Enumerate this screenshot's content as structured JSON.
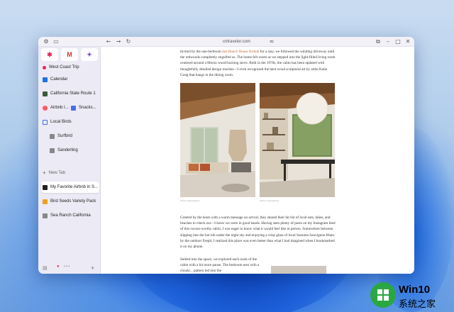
{
  "window": {
    "url": "cntravelor.com"
  },
  "sidebar": {
    "favorites": [
      {
        "icon": "slack-icon",
        "label": "✱",
        "color": "#e0285a"
      },
      {
        "icon": "gmail-icon",
        "label": "M",
        "color": "#d93025"
      },
      {
        "icon": "copilot-icon",
        "label": "✦",
        "color": "#7b4ad4"
      }
    ],
    "pinned_label": "West Coast Trip",
    "items": [
      {
        "label": "Calendar",
        "color": "#1a73e8"
      },
      {
        "label": "California State Route 1",
        "color": "#3a5a3a"
      },
      {
        "label": "Airbnb I...",
        "color": "#ff5a5f"
      },
      {
        "label": "Snacks...",
        "color": "#4a6cf0"
      },
      {
        "label": "Local Birds",
        "color": "#3b6ed8"
      },
      {
        "label": "Surfbird",
        "color": "#555"
      },
      {
        "label": "Sanderling",
        "color": "#555"
      }
    ],
    "new_tab": "New Tab",
    "tabs": [
      {
        "label": "My Favorite Airbnb in S...",
        "color": "#222",
        "active": true
      },
      {
        "label": "Bird Seeds Variety Pack",
        "color": "#f0a020"
      },
      {
        "label": "Sea Ranch California",
        "color": "#444"
      }
    ]
  },
  "article": {
    "p1_pre": "Invited by the one-bedroom ",
    "p1_link": "Sea Ranch House Airbnb",
    "p1_post": " for a stay, we followed the winding driveway until the redwoods completely engulfed us. The home felt warm as we stepped into the light-filled living room centered around a Morso wood-burning stove. Built in the 1970s, the cabin has been updated with thoughtfully detailed design touches—I even recognized the bent wood sculptural art by artist Katie Gong that hangs in the dining room.",
    "caption1": "Trevor Anonymous",
    "caption2": "Trevor Anonymous",
    "p2": "Greeted by the hosts with a warm message on arrival, they shared their hit list of local eats, hikes, and beaches to check out—I knew we were in good hands. Having seen plenty of posts on my Instagram feed of this swoon-worthy cabin, I was eager to know what it would feel like in person. Somewhere between slipping into the hot tub under the night sky and enjoying a crisp glass of local Sonoma Sauvignon Blanc by the outdoor firepit, I realized this place was even better than what I had imagined when I bookmarked it on my phone.",
    "p3": "Settled into the space, we explored each nook of the cabin with a bit more pause. The bedroom nest with a cloudy... pattern led into the"
  },
  "logo": {
    "line1": "Win10",
    "line2": "系统之家"
  }
}
